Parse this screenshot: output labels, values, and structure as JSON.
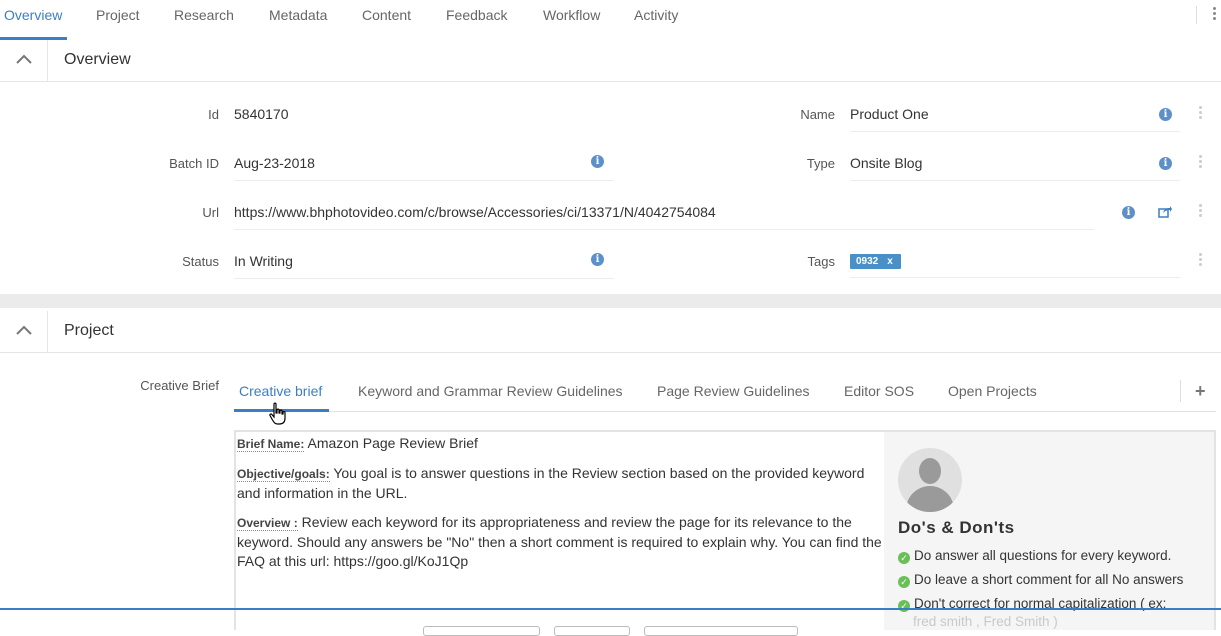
{
  "top_tabs": [
    "Overview",
    "Project",
    "Research",
    "Metadata",
    "Content",
    "Feedback",
    "Workflow",
    "Activity"
  ],
  "overview": {
    "title": "Overview",
    "fields": {
      "id_label": "Id",
      "id_value": "5840170",
      "batch_label": "Batch ID",
      "batch_value": "Aug-23-2018",
      "url_label": "Url",
      "url_value": "https://www.bhphotovideo.com/c/browse/Accessories/ci/13371/N/4042754084",
      "status_label": "Status",
      "status_value": "In Writing",
      "name_label": "Name",
      "name_value": "Product One",
      "type_label": "Type",
      "type_value": "Onsite Blog",
      "tags_label": "Tags",
      "tag_value": "0932",
      "tag_remove": "x"
    }
  },
  "project": {
    "title": "Project",
    "creative_brief_label": "Creative Brief",
    "sub_tabs": [
      "Creative brief",
      "Keyword and Grammar Review Guidelines",
      "Page Review Guidelines",
      "Editor SOS",
      "Open Projects"
    ],
    "add_symbol": "+",
    "brief": {
      "name_key": "Brief Name:",
      "name_value": "Amazon Page Review Brief",
      "objective_key": "Objective/goals:",
      "objective_value": "You goal is to answer questions in the Review section based on the provided keyword and information in the URL.",
      "overview_key": "Overview :",
      "overview_value": "Review each keyword for its appropriateness and review the page for its relevance to the keyword. Should any answers be \"No\" then a short comment is required to explain why. You can find the FAQ at this url: https://goo.gl/KoJ1Qp"
    },
    "dos_donts": {
      "title": "Do's & Don'ts",
      "items": [
        "Do answer all questions for every keyword.",
        "Do leave a short comment for all No answers",
        "Don't correct for normal capitalization ( ex:"
      ],
      "continued": "fred smith , Fred Smith )"
    }
  },
  "colors": {
    "accent": "#3a7fc4",
    "info_icon": "#5d90c8",
    "tag": "#4a90c8",
    "check": "#6bbf59"
  },
  "icons": [
    "chevron-up-icon",
    "info-icon",
    "share-icon",
    "more-vert-icon",
    "plus-icon",
    "check-circle-icon",
    "avatar-icon",
    "hand-cursor-icon"
  ]
}
